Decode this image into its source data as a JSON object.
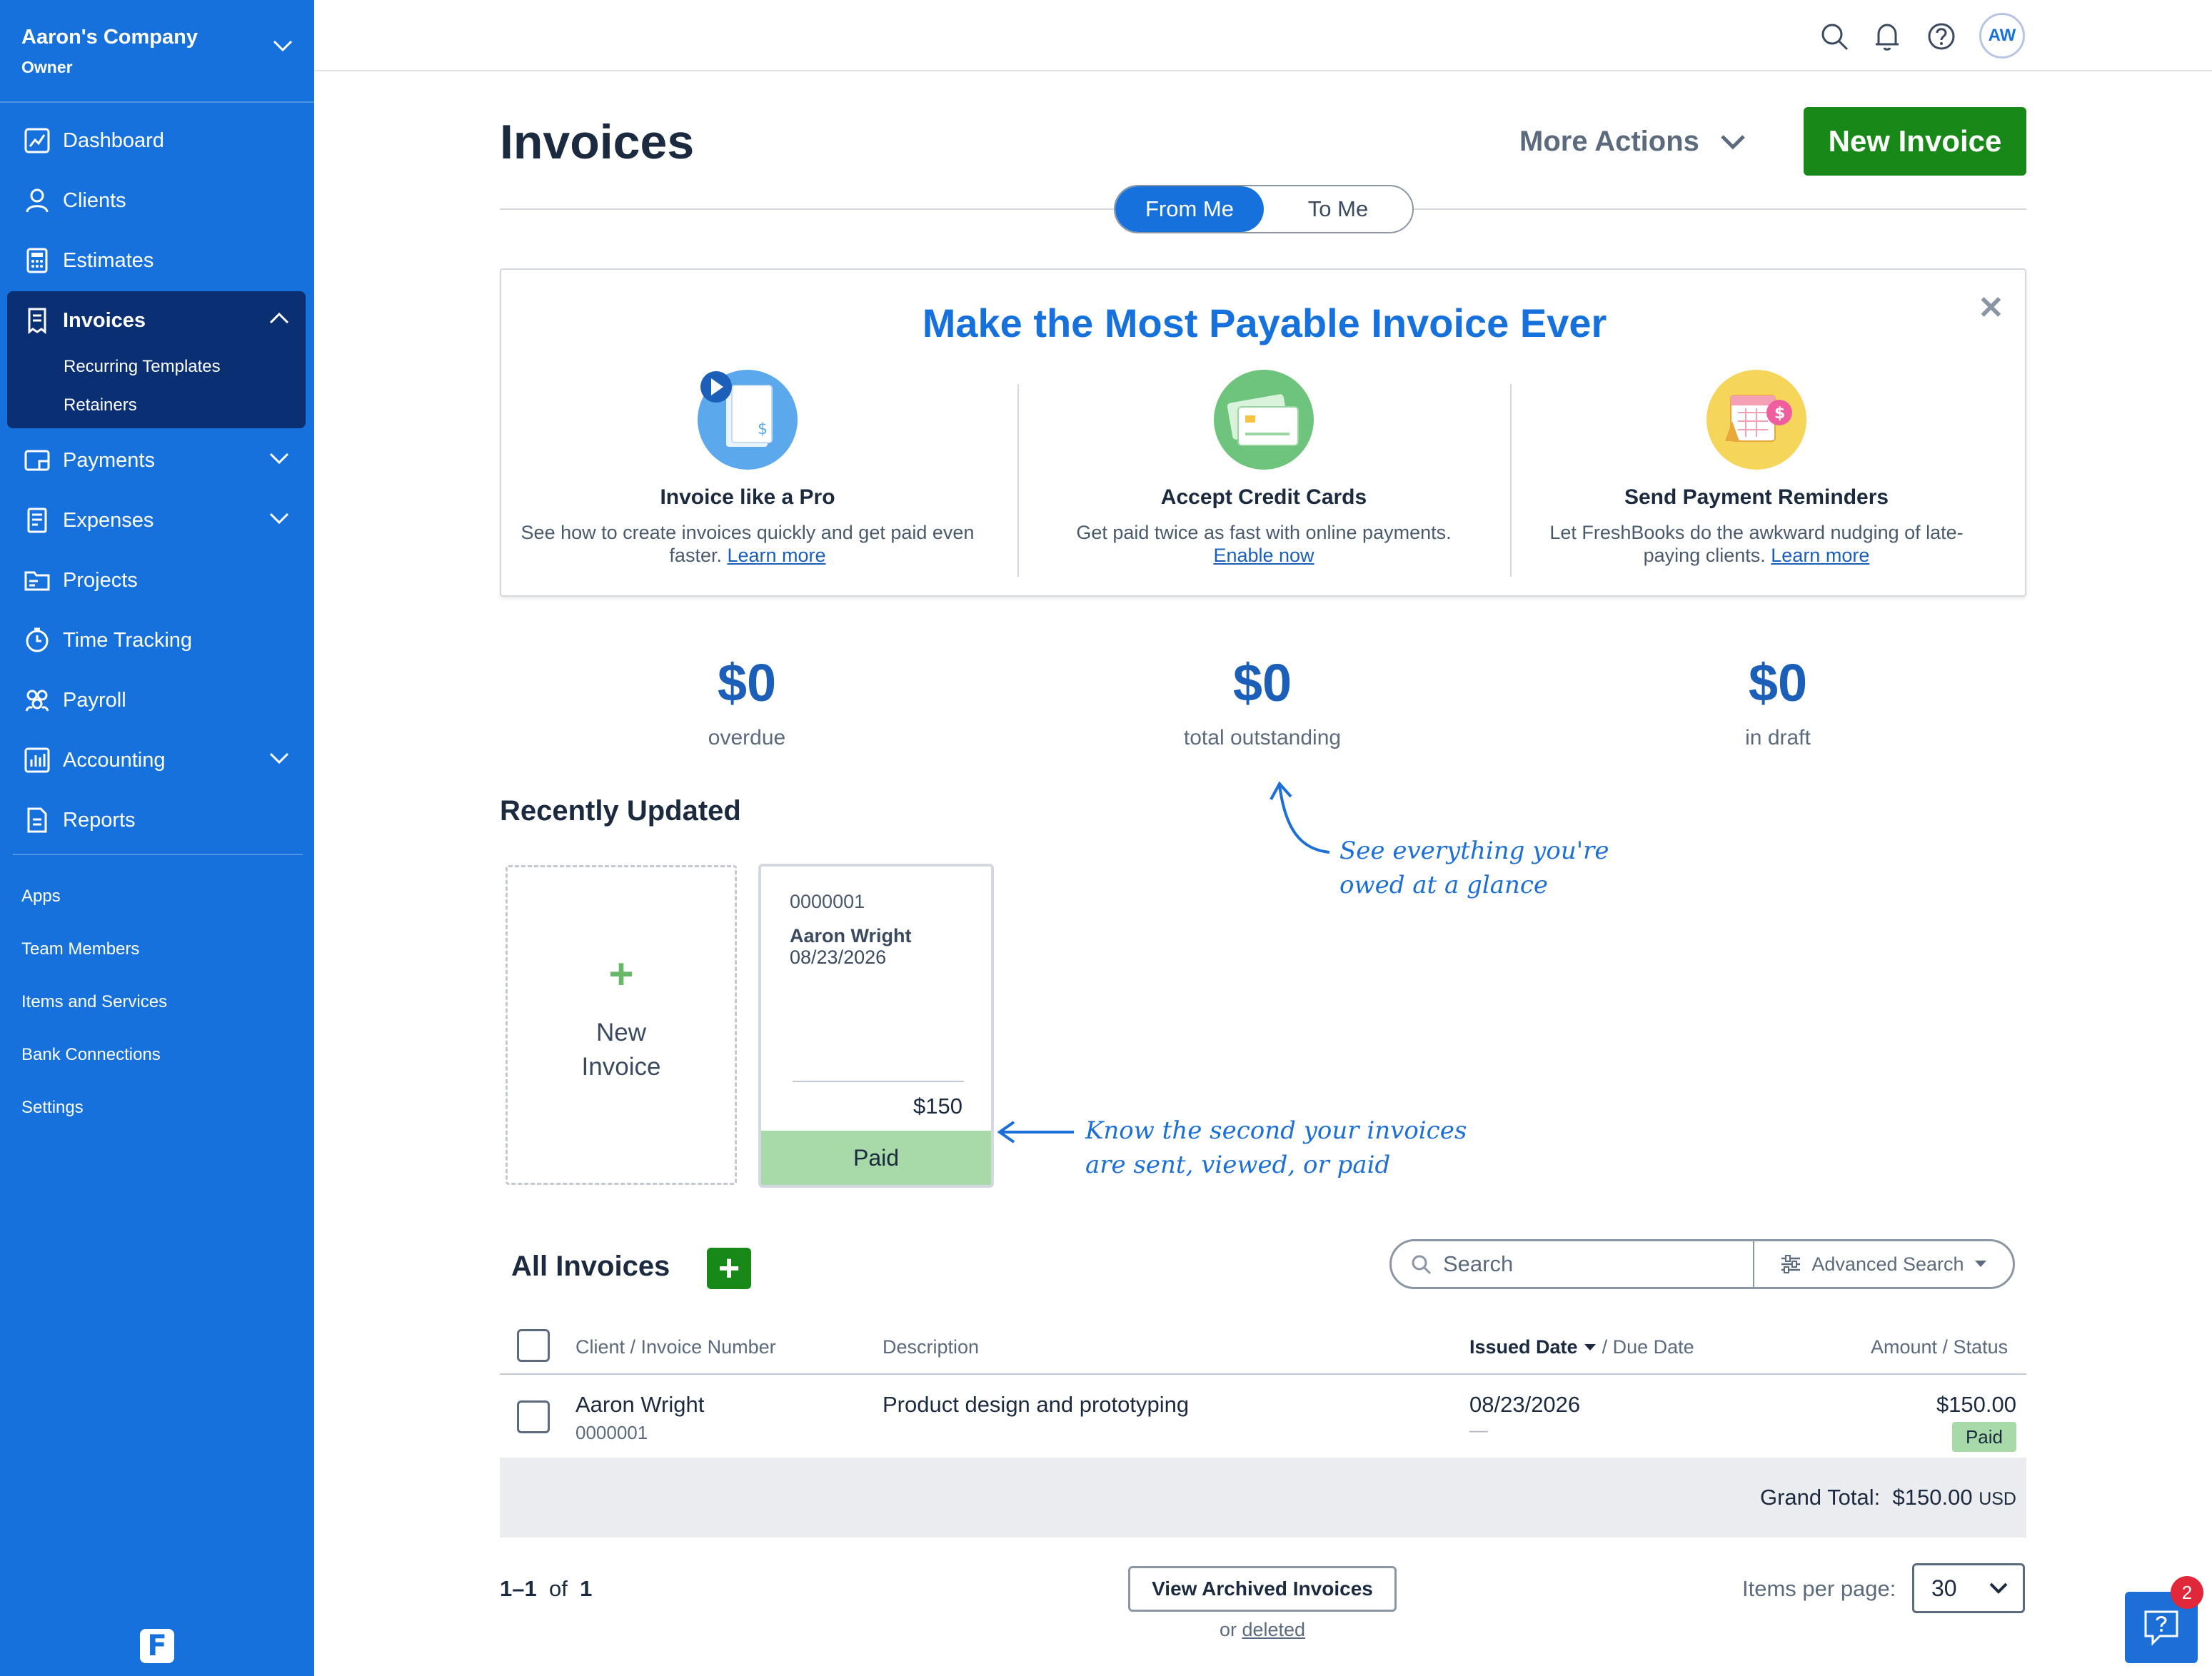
{
  "sidebar": {
    "company_name": "Aaron's Company",
    "company_role": "Owner",
    "nav": {
      "dashboard": "Dashboard",
      "clients": "Clients",
      "estimates": "Estimates",
      "invoices": "Invoices",
      "recurring": "Recurring Templates",
      "retainers": "Retainers",
      "payments": "Payments",
      "expenses": "Expenses",
      "projects": "Projects",
      "time_tracking": "Time Tracking",
      "payroll": "Payroll",
      "accounting": "Accounting",
      "reports": "Reports"
    },
    "bottom": {
      "apps": "Apps",
      "team": "Team Members",
      "items": "Items and Services",
      "bank": "Bank Connections",
      "settings": "Settings"
    },
    "logo_letter": "F"
  },
  "topbar": {
    "avatar_initials": "AW",
    "icons": [
      "search-icon",
      "bell-icon",
      "help-icon"
    ]
  },
  "header": {
    "title": "Invoices",
    "more_actions": "More Actions",
    "new_invoice": "New Invoice",
    "toggle_from": "From Me",
    "toggle_to": "To Me"
  },
  "promo": {
    "title": "Make the Most Payable Invoice Ever",
    "cols": [
      {
        "title": "Invoice like a Pro",
        "desc": "See how to create invoices quickly and get paid even faster.",
        "link": "Learn more"
      },
      {
        "title": "Accept Credit Cards",
        "desc": "Get paid twice as fast with online payments.",
        "link": "Enable now"
      },
      {
        "title": "Send Payment Reminders",
        "desc": "Let FreshBooks do the awkward nudging of late-paying clients.",
        "link": "Learn more"
      }
    ]
  },
  "stats": {
    "overdue_amount": "$0",
    "overdue_label": "overdue",
    "outstanding_amount": "$0",
    "outstanding_label": "total outstanding",
    "draft_amount": "$0",
    "draft_label": "in draft"
  },
  "recent": {
    "title": "Recently Updated",
    "new_card_line1": "New",
    "new_card_line2": "Invoice",
    "card": {
      "number": "0000001",
      "client": "Aaron Wright",
      "date": "08/23/2026",
      "amount": "$150",
      "status": "Paid"
    }
  },
  "notes": {
    "glance_line1": "See everything you're",
    "glance_line2": "owed at a glance",
    "know_line1": "Know the second your invoices",
    "know_line2": "are sent, viewed, or paid"
  },
  "all_invoices": {
    "title": "All Invoices",
    "search_placeholder": "Search",
    "advanced_search": "Advanced Search",
    "columns": {
      "client": "Client / Invoice Number",
      "description": "Description",
      "issued": "Issued Date",
      "due": "/ Due Date",
      "amount": "Amount / Status"
    },
    "rows": [
      {
        "client": "Aaron Wright",
        "number": "0000001",
        "description": "Product design and prototyping",
        "issued": "08/23/2026",
        "due": "—",
        "amount": "$150.00",
        "status": "Paid"
      }
    ],
    "grand_total_label": "Grand Total:",
    "grand_total_value": "$150.00",
    "grand_total_currency": "USD"
  },
  "pagination": {
    "range": "1–1",
    "of": "of",
    "total": "1",
    "archive_button": "View Archived Invoices",
    "or_text": "or",
    "deleted_link": "deleted",
    "items_per_page_label": "Items per page:",
    "items_per_page_value": "30"
  },
  "help": {
    "badge_count": "2"
  }
}
